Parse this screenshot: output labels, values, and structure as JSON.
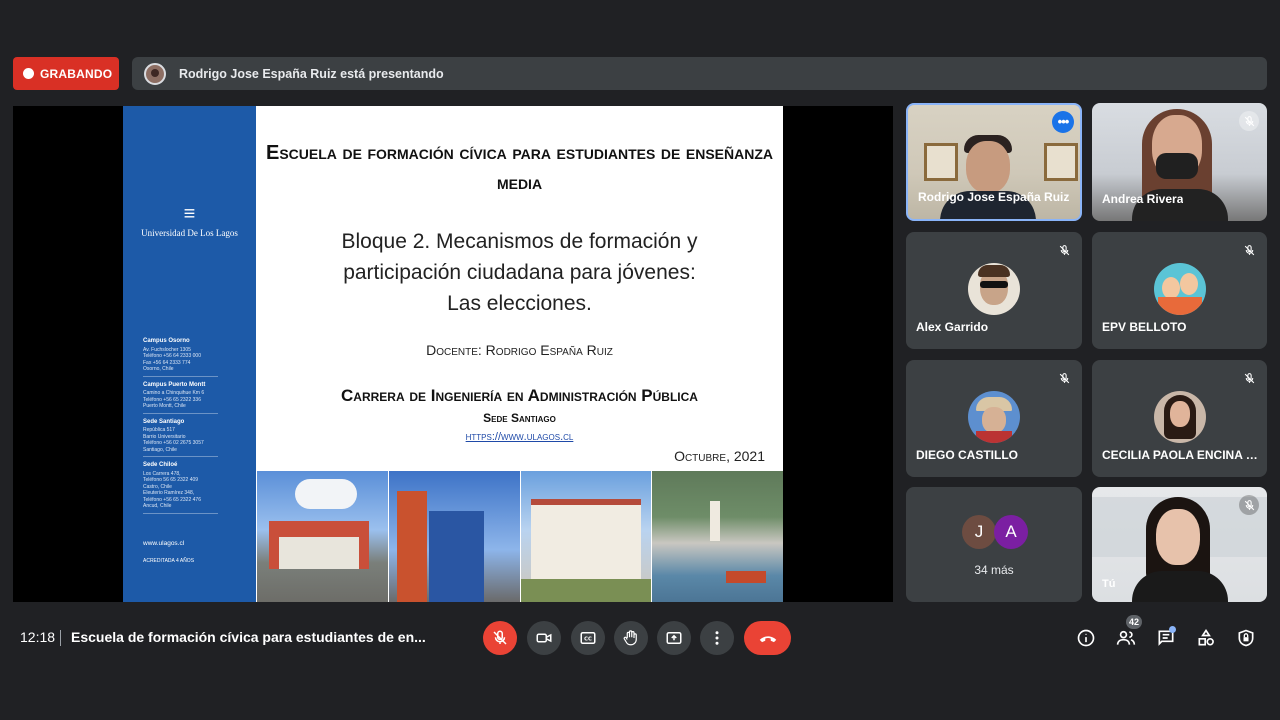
{
  "recording": {
    "label": "GRABANDO"
  },
  "presenting": {
    "text": "Rodrigo Jose España Ruiz está presentando"
  },
  "slide": {
    "side": {
      "logo_text": "Universidad De Los Lagos",
      "campuses": [
        {
          "name": "Campus Osorno",
          "lines": [
            "Av. Fuchslocher 1305",
            "Teléfono +56 64 2333 000",
            "Fax +56 64 2333 774",
            "Osorno, Chile"
          ]
        },
        {
          "name": "Campus Puerto Montt",
          "lines": [
            "Camino a Chinquihue Km 6",
            "Teléfono +56 65 2322 336",
            "Puerto Montt, Chile"
          ]
        },
        {
          "name": "Sede Santiago",
          "lines": [
            "República 517",
            "Barrio Universitario",
            "Teléfono +56 02 2675 3057",
            "Santiago, Chile"
          ]
        },
        {
          "name": "Sede Chiloé",
          "lines": [
            "Los Carrera 478,",
            "Teléfono 56 65 2322 409",
            "Castro, Chile",
            "Eleuterio Ramírez 348,",
            "Teléfono +56 65 2322 476",
            "Ancud, Chile"
          ]
        }
      ],
      "url": "www.ulagos.cl",
      "accreditation": "ACREDITADA 4 AÑOS"
    },
    "title": "Escuela de formación cívica para estudiantes de enseñanza media",
    "block_lines": [
      "Bloque 2. Mecanismos de formación y",
      "participación ciudadana para jóvenes:",
      "Las elecciones."
    ],
    "docente": "Docente: Rodrigo España Ruiz",
    "carrera": "Carrera de Ingeniería en Administración Pública",
    "sede": "Sede Santiago",
    "url": "https://www.ulagos.cl",
    "date": "Octubre, 2021"
  },
  "participants": [
    {
      "name": "Rodrigo Jose España Ruiz",
      "speaking": true
    },
    {
      "name": "Andrea Rivera",
      "muted": true
    },
    {
      "name": "Alex Garrido",
      "muted": true
    },
    {
      "name": "EPV BELLOTO",
      "muted": true
    },
    {
      "name": "DIEGO CASTILLO",
      "muted": true
    },
    {
      "name": "CECILIA PAOLA ENCINA J...",
      "muted": true
    },
    {
      "name": "Tú",
      "muted": true
    }
  ],
  "more_tile": {
    "initials": [
      "J",
      "A"
    ],
    "count_label": "34 más"
  },
  "bottom_bar": {
    "time": "12:18",
    "meeting_name": "Escuela de formación cívica para estudiantes de en...",
    "participant_count": "42"
  },
  "colors": {
    "recording": "#d93025",
    "hangup": "#ea4335",
    "active_border": "#8ab4f8",
    "slide_blue": "#1d5aa8"
  }
}
